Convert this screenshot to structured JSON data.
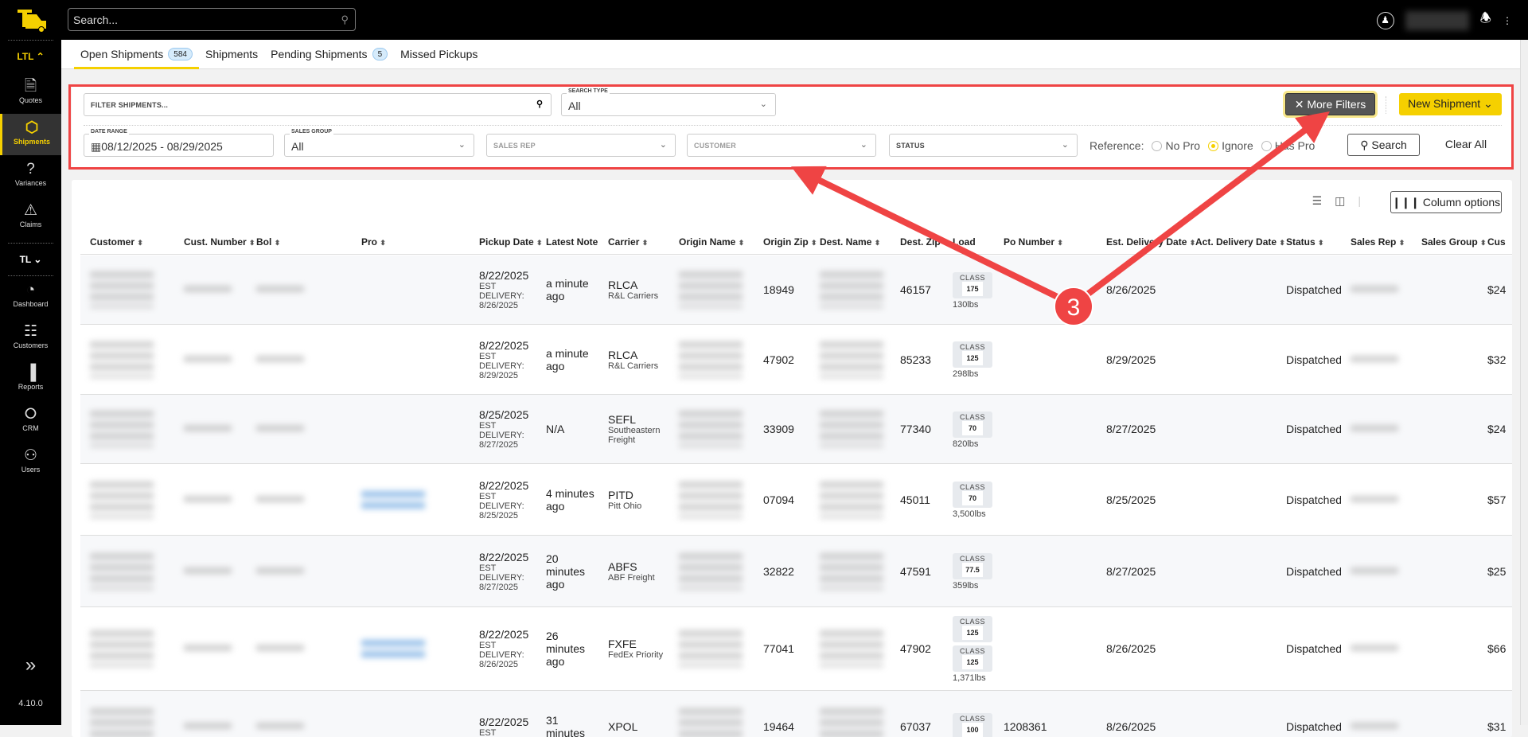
{
  "topbar": {
    "search_placeholder": "Search...",
    "icons": [
      "logo-truck",
      "search-icon",
      "accessibility-icon",
      "bell-icon",
      "more-vertical-icon"
    ]
  },
  "sidebar": {
    "section_ltl": "LTL",
    "section_tl": "TL",
    "ltl_items": [
      {
        "label": "Quotes",
        "icon": "document-icon"
      },
      {
        "label": "Shipments",
        "icon": "box-icon",
        "active": true
      },
      {
        "label": "Variances",
        "icon": "question-icon"
      },
      {
        "label": "Claims",
        "icon": "warning-icon"
      }
    ],
    "tl_items": [
      {
        "label": "Dashboard",
        "icon": "gauge-icon"
      },
      {
        "label": "Customers",
        "icon": "contact-card-icon"
      },
      {
        "label": "Reports",
        "icon": "bar-chart-icon"
      },
      {
        "label": "CRM",
        "icon": "handshake-icon"
      },
      {
        "label": "Users",
        "icon": "users-icon"
      }
    ],
    "version": "4.10.0"
  },
  "tabs": [
    {
      "label": "Open Shipments",
      "badge": "584",
      "active": true
    },
    {
      "label": "Shipments"
    },
    {
      "label": "Pending Shipments",
      "badge": "5"
    },
    {
      "label": "Missed Pickups"
    }
  ],
  "filters": {
    "filter_placeholder": "FILTER SHIPMENTS...",
    "search_type_label": "SEARCH TYPE",
    "search_type_value": "All",
    "more_filters": "More Filters",
    "new_shipment": "New Shipment",
    "date_range_label": "DATE RANGE",
    "date_range_value": "08/12/2025 - 08/29/2025",
    "sales_group_label": "SALES GROUP",
    "sales_group_value": "All",
    "sales_rep_placeholder": "SALES REP",
    "customer_placeholder": "CUSTOMER",
    "status_placeholder": "STATUS",
    "reference_label": "Reference:",
    "reference_options": [
      "No Pro",
      "Ignore",
      "Has Pro"
    ],
    "reference_selected": "Ignore",
    "search_button": "Search",
    "clear_all": "Clear All"
  },
  "table": {
    "column_options": "Column options",
    "columns": [
      "Customer",
      "Cust. Number",
      "Bol",
      "Pro",
      "Pickup Date",
      "Latest Note",
      "Carrier",
      "Origin Name",
      "Origin Zip",
      "Dest. Name",
      "Dest. Zip",
      "Load",
      "Po Number",
      "Est. Delivery Date",
      "Act. Delivery Date",
      "Status",
      "Sales Rep",
      "Sales Group",
      "Cus"
    ],
    "sortable": [
      true,
      true,
      true,
      true,
      true,
      false,
      true,
      true,
      true,
      true,
      true,
      false,
      true,
      true,
      true,
      true,
      true,
      true,
      false
    ],
    "est_label": "EST",
    "delivery_label": "DELIVERY:",
    "class_label": "CLASS",
    "rows": [
      {
        "pickup": "8/22/2025",
        "est": "8/26/2025",
        "note": "a minute ago",
        "carrier": "RLCA",
        "carrier_name": "R&L Carriers",
        "origin_zip": "18949",
        "dest_zip": "46157",
        "classes": [
          "175"
        ],
        "weight": "130lbs",
        "po": "",
        "est_delivery": "8/26/2025",
        "act_delivery": "",
        "status": "Dispatched",
        "cus": "$24",
        "pro_link": false
      },
      {
        "pickup": "8/22/2025",
        "est": "8/29/2025",
        "note": "a minute ago",
        "carrier": "RLCA",
        "carrier_name": "R&L Carriers",
        "origin_zip": "47902",
        "dest_zip": "85233",
        "classes": [
          "125"
        ],
        "weight": "298lbs",
        "po": "",
        "est_delivery": "8/29/2025",
        "act_delivery": "",
        "status": "Dispatched",
        "cus": "$32",
        "pro_link": false
      },
      {
        "pickup": "8/25/2025",
        "est": "8/27/2025",
        "note": "N/A",
        "carrier": "SEFL",
        "carrier_name": "Southeastern Freight",
        "origin_zip": "33909",
        "dest_zip": "77340",
        "classes": [
          "70"
        ],
        "weight": "820lbs",
        "po": "",
        "est_delivery": "8/27/2025",
        "act_delivery": "",
        "status": "Dispatched",
        "cus": "$24",
        "pro_link": false
      },
      {
        "pickup": "8/22/2025",
        "est": "8/25/2025",
        "note": "4 minutes ago",
        "carrier": "PITD",
        "carrier_name": "Pitt Ohio",
        "origin_zip": "07094",
        "dest_zip": "45011",
        "classes": [
          "70"
        ],
        "weight": "3,500lbs",
        "po": "",
        "est_delivery": "8/25/2025",
        "act_delivery": "",
        "status": "Dispatched",
        "cus": "$57",
        "pro_link": true
      },
      {
        "pickup": "8/22/2025",
        "est": "8/27/2025",
        "note": "20 minutes ago",
        "carrier": "ABFS",
        "carrier_name": "ABF Freight",
        "origin_zip": "32822",
        "dest_zip": "47591",
        "classes": [
          "77.5"
        ],
        "weight": "359lbs",
        "po": "",
        "est_delivery": "8/27/2025",
        "act_delivery": "",
        "status": "Dispatched",
        "cus": "$25",
        "pro_link": false
      },
      {
        "pickup": "8/22/2025",
        "est": "8/26/2025",
        "note": "26 minutes ago",
        "carrier": "FXFE",
        "carrier_name": "FedEx Priority",
        "origin_zip": "77041",
        "dest_zip": "47902",
        "classes": [
          "125",
          "125"
        ],
        "weight": "1,371lbs",
        "po": "",
        "est_delivery": "8/26/2025",
        "act_delivery": "",
        "status": "Dispatched",
        "cus": "$66",
        "pro_link": true
      },
      {
        "pickup": "8/22/2025",
        "est": "",
        "note": "31 minutes",
        "carrier": "XPOL",
        "carrier_name": "",
        "origin_zip": "19464",
        "dest_zip": "67037",
        "classes": [
          "100"
        ],
        "weight": "",
        "po": "1208361",
        "est_delivery": "8/26/2025",
        "act_delivery": "",
        "status": "Dispatched",
        "cus": "$31",
        "pro_link": false
      }
    ]
  },
  "annotation": {
    "step": "3",
    "color": "#ef4444"
  },
  "colors": {
    "accent": "#f5d000",
    "annotation": "#ef4444",
    "sidebar": "#000000"
  }
}
